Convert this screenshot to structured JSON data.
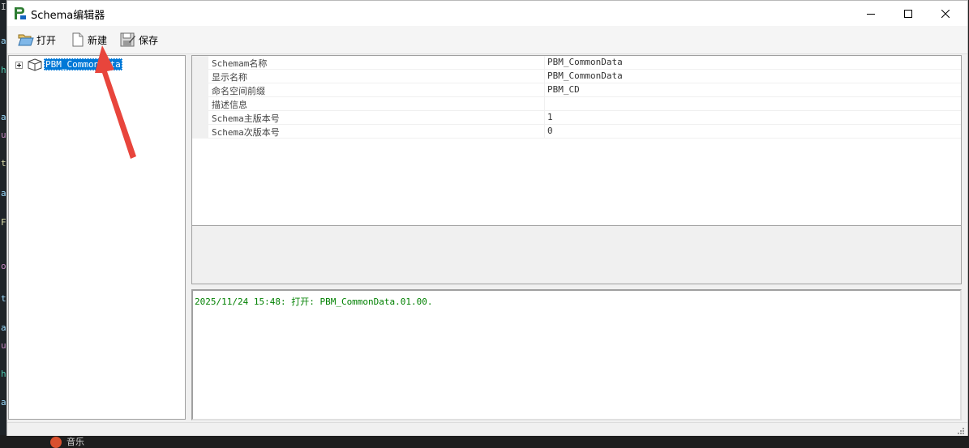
{
  "window": {
    "title": "Schema编辑器"
  },
  "toolbar": {
    "open_label": "打开",
    "new_label": "新建",
    "save_label": "保存"
  },
  "tree": {
    "root_label": "PBM_CommonData"
  },
  "properties": [
    {
      "name": "Schemam名称",
      "value": "PBM_CommonData"
    },
    {
      "name": "显示名称",
      "value": "PBM_CommonData"
    },
    {
      "name": "命名空间前缀",
      "value": "PBM_CD"
    },
    {
      "name": "描述信息",
      "value": ""
    },
    {
      "name": "Schema主版本号",
      "value": "1"
    },
    {
      "name": "Schema次版本号",
      "value": "0"
    }
  ],
  "log": {
    "line": "2025/11/24 15:48: 打开: PBM_CommonData.01.00."
  },
  "background": {
    "taskbar_text": "音乐"
  },
  "colors": {
    "accent": "#0078d7",
    "log_text": "#008000",
    "annotation": "#e8453c"
  }
}
